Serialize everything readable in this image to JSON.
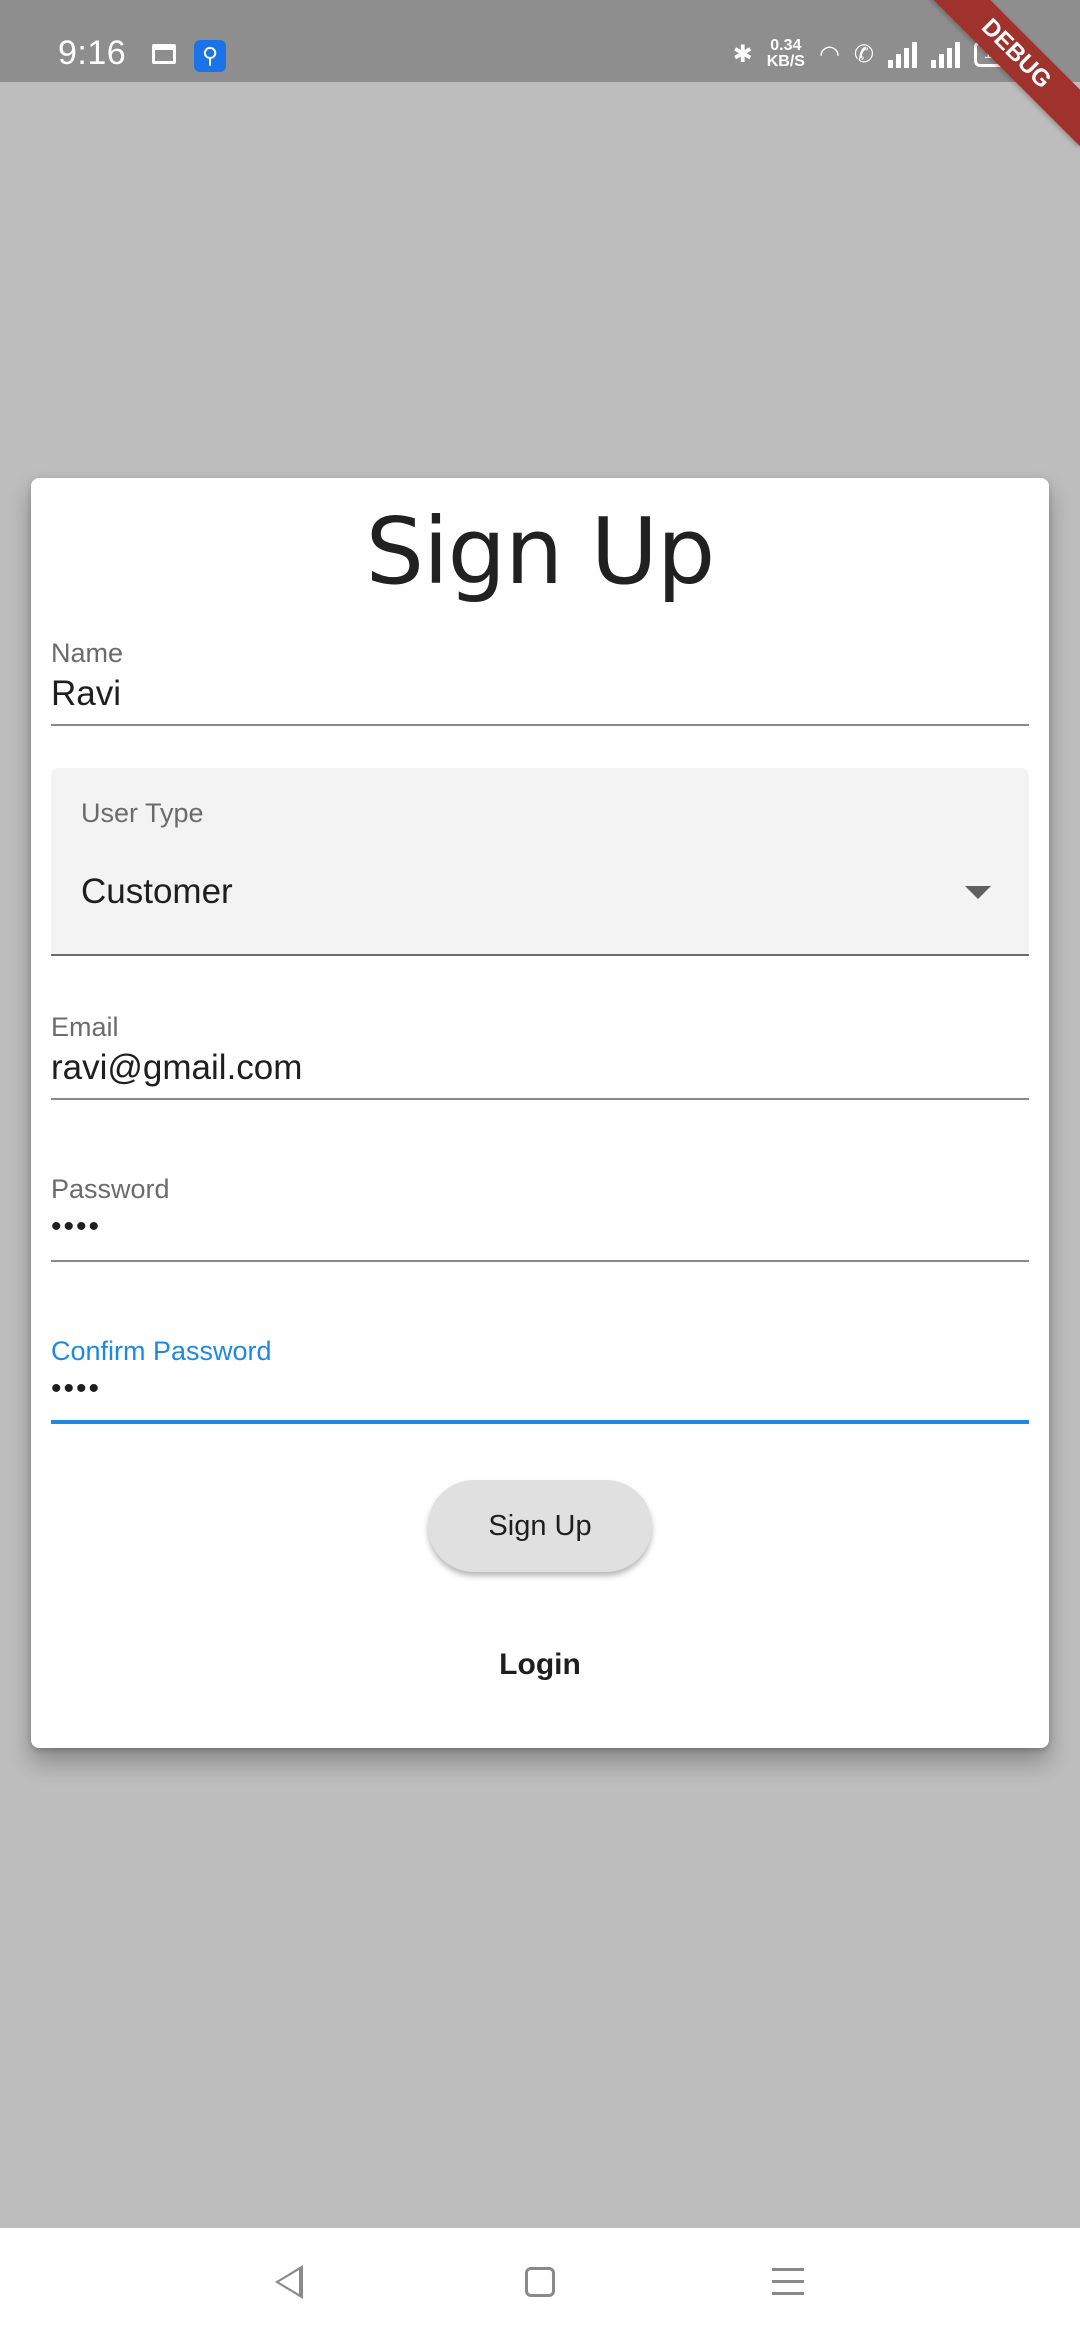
{
  "status_bar": {
    "time": "9:16",
    "network_speed": "0.34",
    "network_speed_unit": "KB/S",
    "battery": "100",
    "debug_banner": "DEBUG"
  },
  "form": {
    "title": "Sign Up",
    "name": {
      "label": "Name",
      "value": "Ravi"
    },
    "user_type": {
      "label": "User Type",
      "value": "Customer"
    },
    "email": {
      "label": "Email",
      "value": "ravi@gmail.com"
    },
    "password": {
      "label": "Password",
      "value": "••••"
    },
    "confirm_password": {
      "label": "Confirm Password",
      "value": "••••"
    },
    "signup_button": "Sign Up",
    "login_link": "Login"
  },
  "colors": {
    "background": "#bdbdbd",
    "accent": "#1e88e5",
    "debug": "#a0322e"
  }
}
